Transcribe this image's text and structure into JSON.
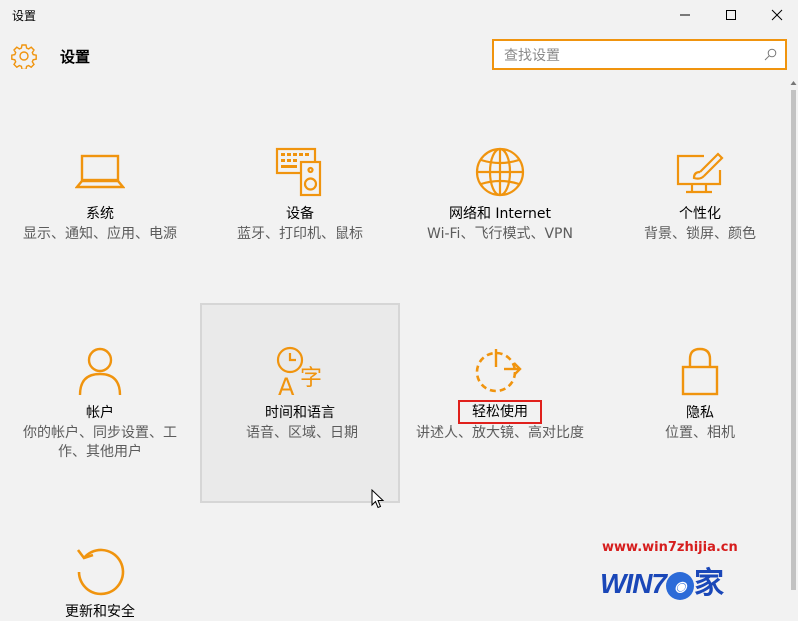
{
  "window": {
    "title": "设置",
    "controls": {
      "minimize": "minimize-icon",
      "maximize": "maximize-icon",
      "close": "close-icon"
    }
  },
  "header": {
    "title": "设置",
    "icon": "gear-icon"
  },
  "search": {
    "placeholder": "查找设置",
    "icon": "search-icon"
  },
  "accent": "#f0940e",
  "categories": [
    {
      "name": "系统",
      "desc": "显示、通知、应用、电源",
      "icon": "laptop-icon"
    },
    {
      "name": "设备",
      "desc": "蓝牙、打印机、鼠标",
      "icon": "devices-icon"
    },
    {
      "name": "网络和 Internet",
      "desc": "Wi-Fi、飞行模式、VPN",
      "icon": "globe-icon"
    },
    {
      "name": "个性化",
      "desc": "背景、锁屏、颜色",
      "icon": "paint-icon"
    },
    {
      "name": "帐户",
      "desc": "你的帐户、同步设置、工作、其他用户",
      "icon": "person-icon"
    },
    {
      "name": "时间和语言",
      "desc": "语音、区域、日期",
      "icon": "time-language-icon"
    },
    {
      "name": "轻松使用",
      "desc": "讲述人、放大镜、高对比度",
      "icon": "ease-of-access-icon"
    },
    {
      "name": "隐私",
      "desc": "位置、相机",
      "icon": "lock-icon"
    },
    {
      "name": "更新和安全",
      "desc": "",
      "icon": "update-icon"
    }
  ],
  "watermark": {
    "url": "www.win7zhijia.cn",
    "logo": "WIN7",
    "logo_char": "家"
  }
}
